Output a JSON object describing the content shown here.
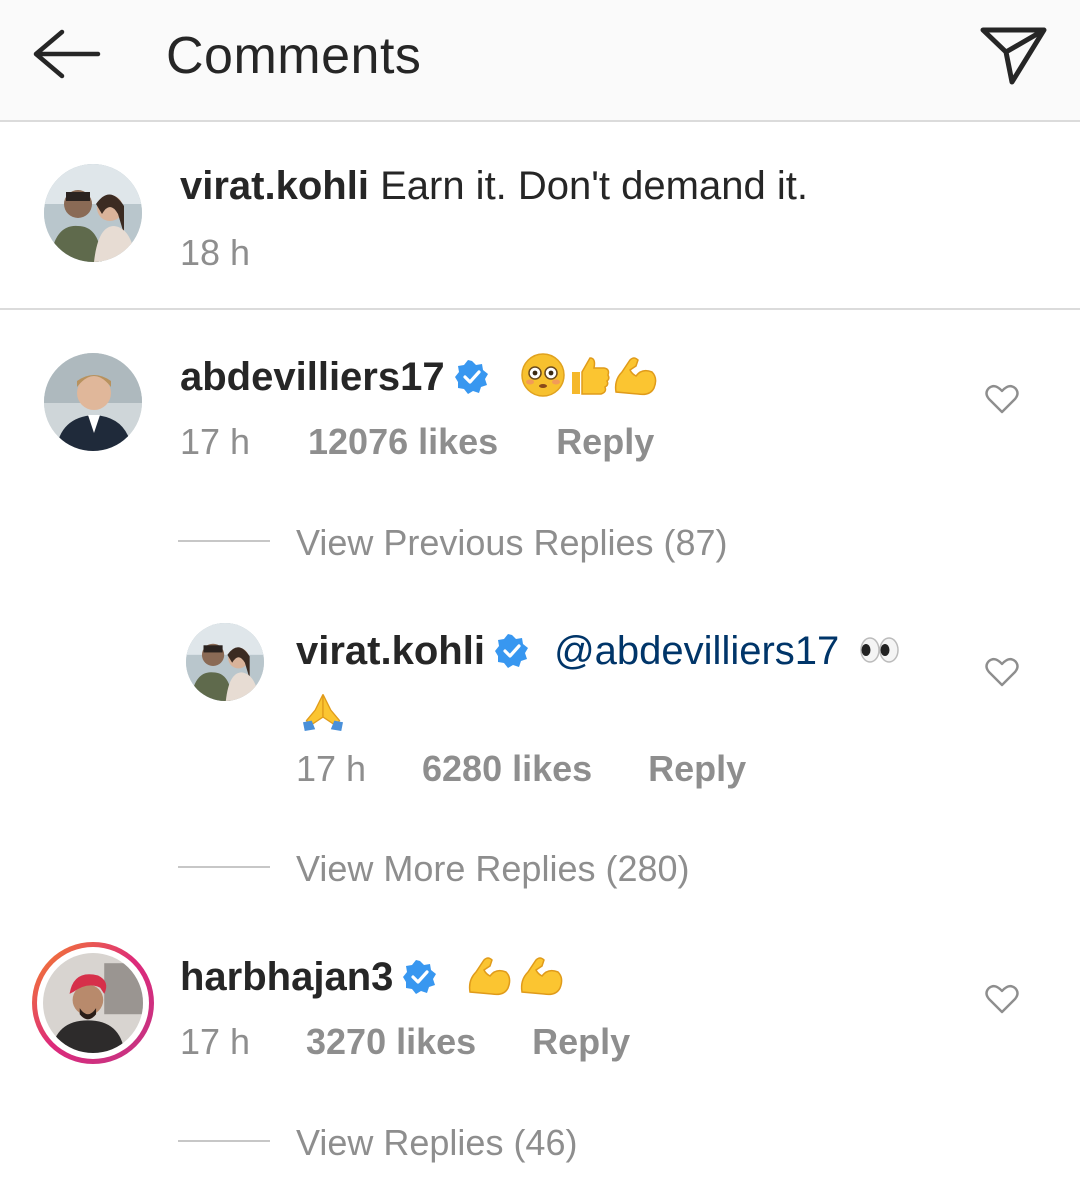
{
  "header": {
    "title": "Comments"
  },
  "caption": {
    "username": "virat.kohli",
    "text": "Earn it. Don't demand it.",
    "time": "18 h"
  },
  "comments": [
    {
      "username": "abdevilliers17",
      "verified": true,
      "emojis": [
        "flushed-face",
        "thumbs-up",
        "flexed-biceps"
      ],
      "time": "17 h",
      "likes": "12076 likes",
      "reply": "Reply",
      "view_replies": "View Previous Replies (87)",
      "replies": [
        {
          "username": "virat.kohli",
          "verified": true,
          "mention": "@abdevilliers17",
          "emojis": [
            "eyes",
            "folded-hands"
          ],
          "time": "17 h",
          "likes": "6280 likes",
          "reply": "Reply"
        }
      ],
      "view_more": "View More Replies (280)"
    },
    {
      "username": "harbhajan3",
      "verified": true,
      "has_story_ring": true,
      "emojis": [
        "flexed-biceps",
        "flexed-biceps"
      ],
      "time": "17 h",
      "likes": "3270 likes",
      "reply": "Reply",
      "view_replies": "View Replies (46)"
    }
  ],
  "colors": {
    "verified": "#3897f0",
    "mention": "#003569",
    "muted": "#8e8e8e",
    "story_ring_start": "#f58529",
    "story_ring_end": "#c13584"
  }
}
